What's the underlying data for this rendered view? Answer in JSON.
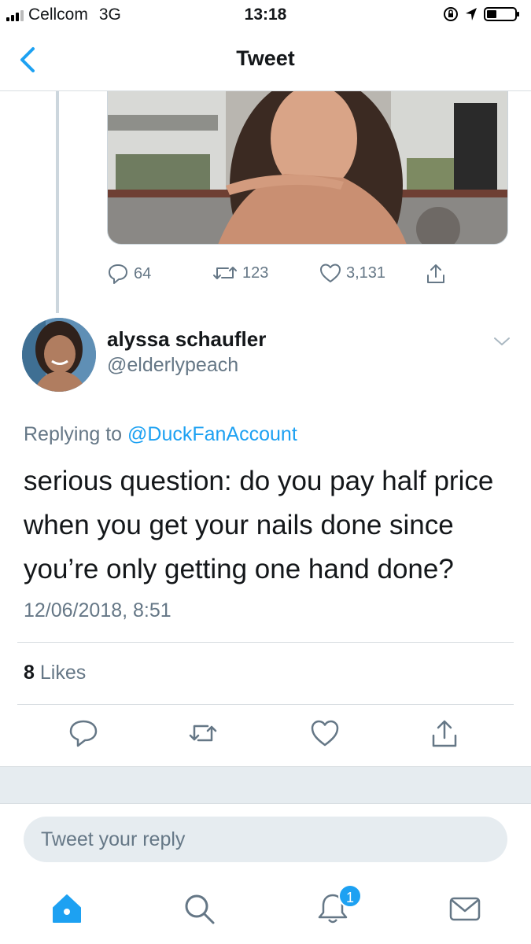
{
  "status_bar": {
    "carrier": "Cellcom",
    "network": "3G",
    "time": "13:18"
  },
  "nav": {
    "title": "Tweet"
  },
  "previous_tweet": {
    "reply_count": "64",
    "retweet_count": "123",
    "like_count": "3,131"
  },
  "tweet": {
    "display_name": "alyssa schaufler",
    "handle": "@elderlypeach",
    "replying_prefix": "Replying to",
    "replying_to": "@DuckFanAccount",
    "text": "serious question: do you pay half price when you get your nails done since you’re only getting one hand done?",
    "timestamp": "12/06/2018, 8:51",
    "likes_count": "8",
    "likes_label": "Likes"
  },
  "reply": {
    "placeholder": "Tweet your reply"
  },
  "tab_bar": {
    "notifications_badge": "1"
  },
  "colors": {
    "accent": "#1da1f2",
    "secondary_text": "#657786",
    "divider": "#d8dde1",
    "band": "#e6ecf0"
  },
  "icons": [
    "back-chevron-icon",
    "reply-icon",
    "retweet-icon",
    "like-icon",
    "share-icon",
    "caret-down-icon",
    "home-icon",
    "search-icon",
    "notifications-icon",
    "messages-icon"
  ]
}
